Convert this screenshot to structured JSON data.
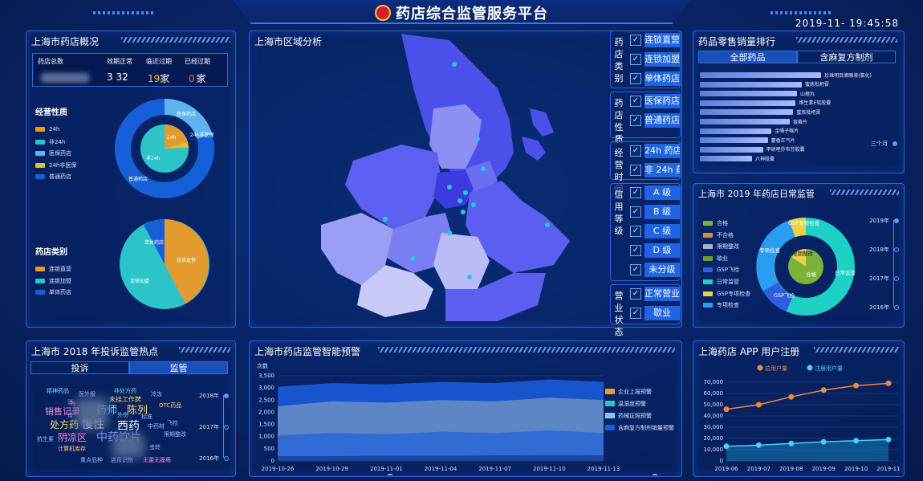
{
  "header": {
    "title": "药店综合监管服务平台",
    "datetime": "2019-11-  19:45:58"
  },
  "overview": {
    "title": "上海市药店概况",
    "labels": [
      "药店总数",
      "效期正常",
      "临近过期",
      "已经过期"
    ],
    "expired_count": "0",
    "normal_count_visible": "3  32",
    "near_count_visible": "19",
    "unit": "家",
    "nature_title": "经营性质",
    "nature_legend": [
      {
        "label": "24h",
        "color": "#e39a2f"
      },
      {
        "label": "非24h",
        "color": "#2cc4c8"
      },
      {
        "label": "医保药店",
        "color": "#5fb4f0"
      },
      {
        "label": "24h非医保",
        "color": "#d8c23a"
      },
      {
        "label": "普通药店",
        "color": "#1560d8"
      }
    ],
    "nature_ring_labels": [
      "医保药店",
      "24h非医保",
      "24h",
      "非24h",
      "普通药店"
    ],
    "category_title": "药店类别",
    "category_legend": [
      {
        "label": "连锁直营",
        "color": "#e39a2f"
      },
      {
        "label": "连锁加盟",
        "color": "#2cc4c8"
      },
      {
        "label": "单体药店",
        "color": "#1560d8"
      }
    ],
    "category_pie_labels": [
      "单体药店",
      "连锁直营",
      "连锁加盟"
    ]
  },
  "map": {
    "title": "上海市区域分析"
  },
  "filters": {
    "groups": [
      {
        "label": "药店类别",
        "items": [
          "连锁直营",
          "连锁加盟",
          "单体药店"
        ]
      },
      {
        "label": "药店性质",
        "items": [
          "医保药店",
          "普通药店"
        ]
      },
      {
        "label": "经营时间",
        "items": [
          "24h 药店",
          "非 24h 药店"
        ]
      },
      {
        "label": "信用等级",
        "items": [
          "A 级",
          "B 级",
          "C 级",
          "D 级",
          "未分级"
        ]
      },
      {
        "label": "营业状态",
        "items": [
          "正常营业",
          "歇业"
        ]
      }
    ],
    "check": "✓"
  },
  "sales": {
    "title": "药品零售销量排行",
    "tabs": [
      "全部药品",
      "含麻复方制剂"
    ],
    "items": [
      {
        "name": "珍珠明目滴眼液(氯化)",
        "value": 1.0
      },
      {
        "name": "蜜炼枇杷膏",
        "value": 0.84
      },
      {
        "name": "山楂丸",
        "value": 0.8
      },
      {
        "name": "维生素E软胶囊",
        "value": 0.79
      },
      {
        "name": "蜜炼枇杷膏",
        "value": 0.77
      },
      {
        "name": "银黄片",
        "value": 0.74
      },
      {
        "name": "金嗓子喉片",
        "value": 0.59
      },
      {
        "name": "藿香正气片",
        "value": 0.56
      },
      {
        "name": "甲硝唑芬布芬胶囊",
        "value": 0.52
      },
      {
        "name": "六神胶囊",
        "value": 0.43
      }
    ],
    "timeline": [
      "三个月"
    ]
  },
  "daily": {
    "title": "上海市 2019 年药店日常监管",
    "legend": [
      {
        "label": "合格",
        "color": "#7ab23a"
      },
      {
        "label": "不合格",
        "color": "#e3873a"
      },
      {
        "label": "限期整改",
        "color": "#a8b0c4"
      },
      {
        "label": "歇业",
        "color": "#6c9c24"
      },
      {
        "label": "GSP飞检",
        "color": "#2f5fe0"
      },
      {
        "label": "日常监管",
        "color": "#1fd0c4"
      },
      {
        "label": "GSP专项检查",
        "color": "#e8d24a"
      },
      {
        "label": "专项检查",
        "color": "#2a9df0"
      }
    ],
    "ring_labels": [
      "GSP专项检查",
      "专项检查",
      "日常监管",
      "GSP飞检",
      "合格",
      "限期整改"
    ],
    "years": [
      "2019年",
      "2018年",
      "2017年",
      "2016年"
    ]
  },
  "complaints": {
    "title": "上海市 2018 年投诉监管热点",
    "tabs": [
      "投诉",
      "监管"
    ],
    "words": [
      {
        "t": "精神药品",
        "c": "#7fd1ff",
        "s": 7
      },
      {
        "t": "医外服",
        "c": "#aab8ff",
        "s": 7
      },
      {
        "t": "非处方药",
        "c": "#6fe6c8",
        "s": 7
      },
      {
        "t": "未挂工作牌",
        "c": "#ffd56b",
        "s": 8
      },
      {
        "t": "冷冻",
        "c": "#aab8ff",
        "s": 7
      },
      {
        "t": "销售记录",
        "c": "#ff8ad6",
        "s": 11
      },
      {
        "t": "药师",
        "c": "#7fd1ff",
        "s": 13
      },
      {
        "t": "陈列",
        "c": "#ffd56b",
        "s": 13
      },
      {
        "t": "OTC药品",
        "c": "#ffd56b",
        "s": 7
      },
      {
        "t": "冷",
        "c": "#ff6b6b",
        "s": 7
      },
      {
        "t": "处方药",
        "c": "#ffd56b",
        "s": 12
      },
      {
        "t": "慢性",
        "c": "#ffffff",
        "s": 14
      },
      {
        "t": "西药",
        "c": "#ffffff",
        "s": 14
      },
      {
        "t": "标准",
        "c": "#aab8ff",
        "s": 7
      },
      {
        "t": "中药材",
        "c": "#aab8ff",
        "s": 7
      },
      {
        "t": "外伤",
        "c": "#7fd1ff",
        "s": 7
      },
      {
        "t": "飞检",
        "c": "#aab8ff",
        "s": 7
      },
      {
        "t": "阴凉区",
        "c": "#ff8ad6",
        "s": 12
      },
      {
        "t": "中药饮片",
        "c": "#7f9bff",
        "s": 14
      },
      {
        "t": "限期整改",
        "c": "#aab8ff",
        "s": 7
      },
      {
        "t": "抗生素",
        "c": "#aab8ff",
        "s": 7
      },
      {
        "t": "计算机库存",
        "c": "#ffd56b",
        "s": 7
      },
      {
        "t": "虫蛀",
        "c": "#aab8ff",
        "s": 7
      },
      {
        "t": "重点品种",
        "c": "#aab8ff",
        "s": 7
      },
      {
        "t": "店员识别",
        "c": "#aab8ff",
        "s": 7
      },
      {
        "t": "无菌无膜瘾",
        "c": "#ff8ad6",
        "s": 7
      },
      {
        "t": "消",
        "c": "#aab8ff",
        "s": 7
      },
      {
        "t": "肖",
        "c": "#aab8ff",
        "s": 7
      }
    ],
    "years": [
      "2018年",
      "2017年",
      "2016年"
    ]
  },
  "warning": {
    "title": "上海市药店监管智能预警",
    "unit_label": "次数",
    "legend": [
      {
        "label": "企业上报预警",
        "color": "#e39a2f"
      },
      {
        "label": "温湿度预警",
        "color": "#2cc4c8"
      },
      {
        "label": "药械证照预警",
        "color": "#7fc6ff"
      },
      {
        "label": "含麻复方制剂销量预警",
        "color": "#1560d8"
      }
    ]
  },
  "app": {
    "title": "上海药店 APP 用户注册",
    "legend": [
      {
        "label": "总用户量",
        "color": "#f08a3c"
      },
      {
        "label": "注册用户量",
        "color": "#4ad0f5"
      }
    ]
  },
  "chart_data": [
    {
      "type": "area",
      "title": "",
      "ylabel": "次数",
      "x": [
        "2019-10-26",
        "2019-10-29",
        "2019-11-01",
        "2019-11-04",
        "2019-11-07",
        "2019-11-10",
        "2019-11-13"
      ],
      "ylim": [
        0,
        3500
      ],
      "yticks": [
        0,
        500,
        1000,
        1500,
        2000,
        2500,
        3000,
        3500
      ],
      "series": [
        {
          "name": "含麻复方制剂销量预警",
          "values": [
            3050,
            3200,
            3150,
            3250,
            3200,
            3350,
            3250
          ]
        },
        {
          "name": "药械证照预警",
          "values": [
            2250,
            2450,
            2400,
            2500,
            2450,
            2600,
            2500
          ]
        },
        {
          "name": "温湿度预警",
          "values": [
            1050,
            1150,
            1100,
            1200,
            1150,
            1250,
            1150
          ]
        },
        {
          "name": "企业上报预警",
          "values": [
            200,
            200,
            220,
            210,
            230,
            240,
            230
          ]
        }
      ]
    },
    {
      "type": "line",
      "title": "",
      "x": [
        "2019-06",
        "2019-07",
        "2019-08",
        "2019-09",
        "2019-10",
        "2019-11"
      ],
      "ylim": [
        0,
        70000
      ],
      "yticks": [
        0,
        10000,
        20000,
        30000,
        40000,
        50000,
        60000,
        70000
      ],
      "series": [
        {
          "name": "总用户量",
          "values": [
            46000,
            50000,
            57000,
            63000,
            67000,
            69000
          ]
        },
        {
          "name": "注册用户量",
          "values": [
            13000,
            14000,
            15500,
            17000,
            18000,
            19000
          ]
        }
      ]
    }
  ]
}
